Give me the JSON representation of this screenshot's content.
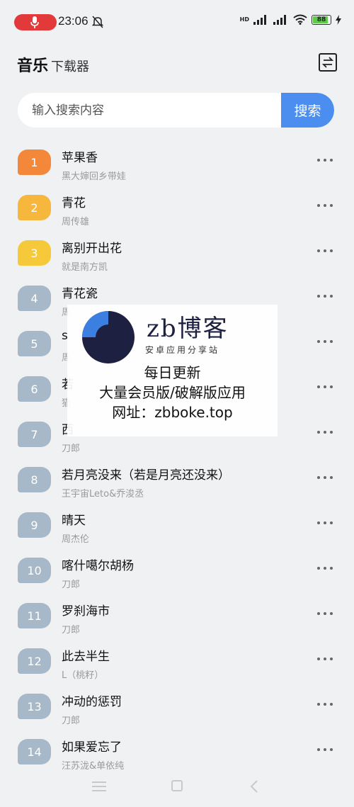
{
  "status_bar": {
    "time": "23:06",
    "network_label": "HD",
    "battery": "88",
    "battery_level": 0.88
  },
  "header": {
    "title_main": "音乐",
    "title_sub": "下载器"
  },
  "search": {
    "placeholder": "输入搜索内容",
    "button_label": "搜索"
  },
  "colors": {
    "accent": "#4b8ef0",
    "rank1": "#f4883a",
    "rank2": "#f6b73c",
    "rank3": "#f5c93a",
    "rank_other": "#a7b8c8"
  },
  "songs": [
    {
      "rank": "1",
      "title": "苹果香",
      "artist": "黑大婶回乡带娃"
    },
    {
      "rank": "2",
      "title": "青花",
      "artist": "周传雄"
    },
    {
      "rank": "3",
      "title": "离别开出花",
      "artist": "就是南方凯"
    },
    {
      "rank": "4",
      "title": "青花瓷",
      "artist": "周"
    },
    {
      "rank": "5",
      "title": "s",
      "artist": "周"
    },
    {
      "rank": "6",
      "title": "若",
      "artist": "猫"
    },
    {
      "rank": "7",
      "title": "西",
      "artist": "刀郎"
    },
    {
      "rank": "8",
      "title": "若月亮没来（若是月亮还没来）",
      "artist": "王宇宙Leto&乔浚丞"
    },
    {
      "rank": "9",
      "title": "晴天",
      "artist": "周杰伦"
    },
    {
      "rank": "10",
      "title": "喀什噶尔胡杨",
      "artist": "刀郎"
    },
    {
      "rank": "11",
      "title": "罗刹海市",
      "artist": "刀郎"
    },
    {
      "rank": "12",
      "title": "此去半生",
      "artist": "L（桃籽）"
    },
    {
      "rank": "13",
      "title": "冲动的惩罚",
      "artist": "刀郎"
    },
    {
      "rank": "14",
      "title": "如果爱忘了",
      "artist": "汪苏泷&单依纯"
    }
  ],
  "watermark": {
    "brand": "zb博客",
    "tagline": "安卓应用分享站",
    "line1": "每日更新",
    "line2": "大量会员版/破解版应用",
    "line3": "网址：zbboke.top"
  }
}
